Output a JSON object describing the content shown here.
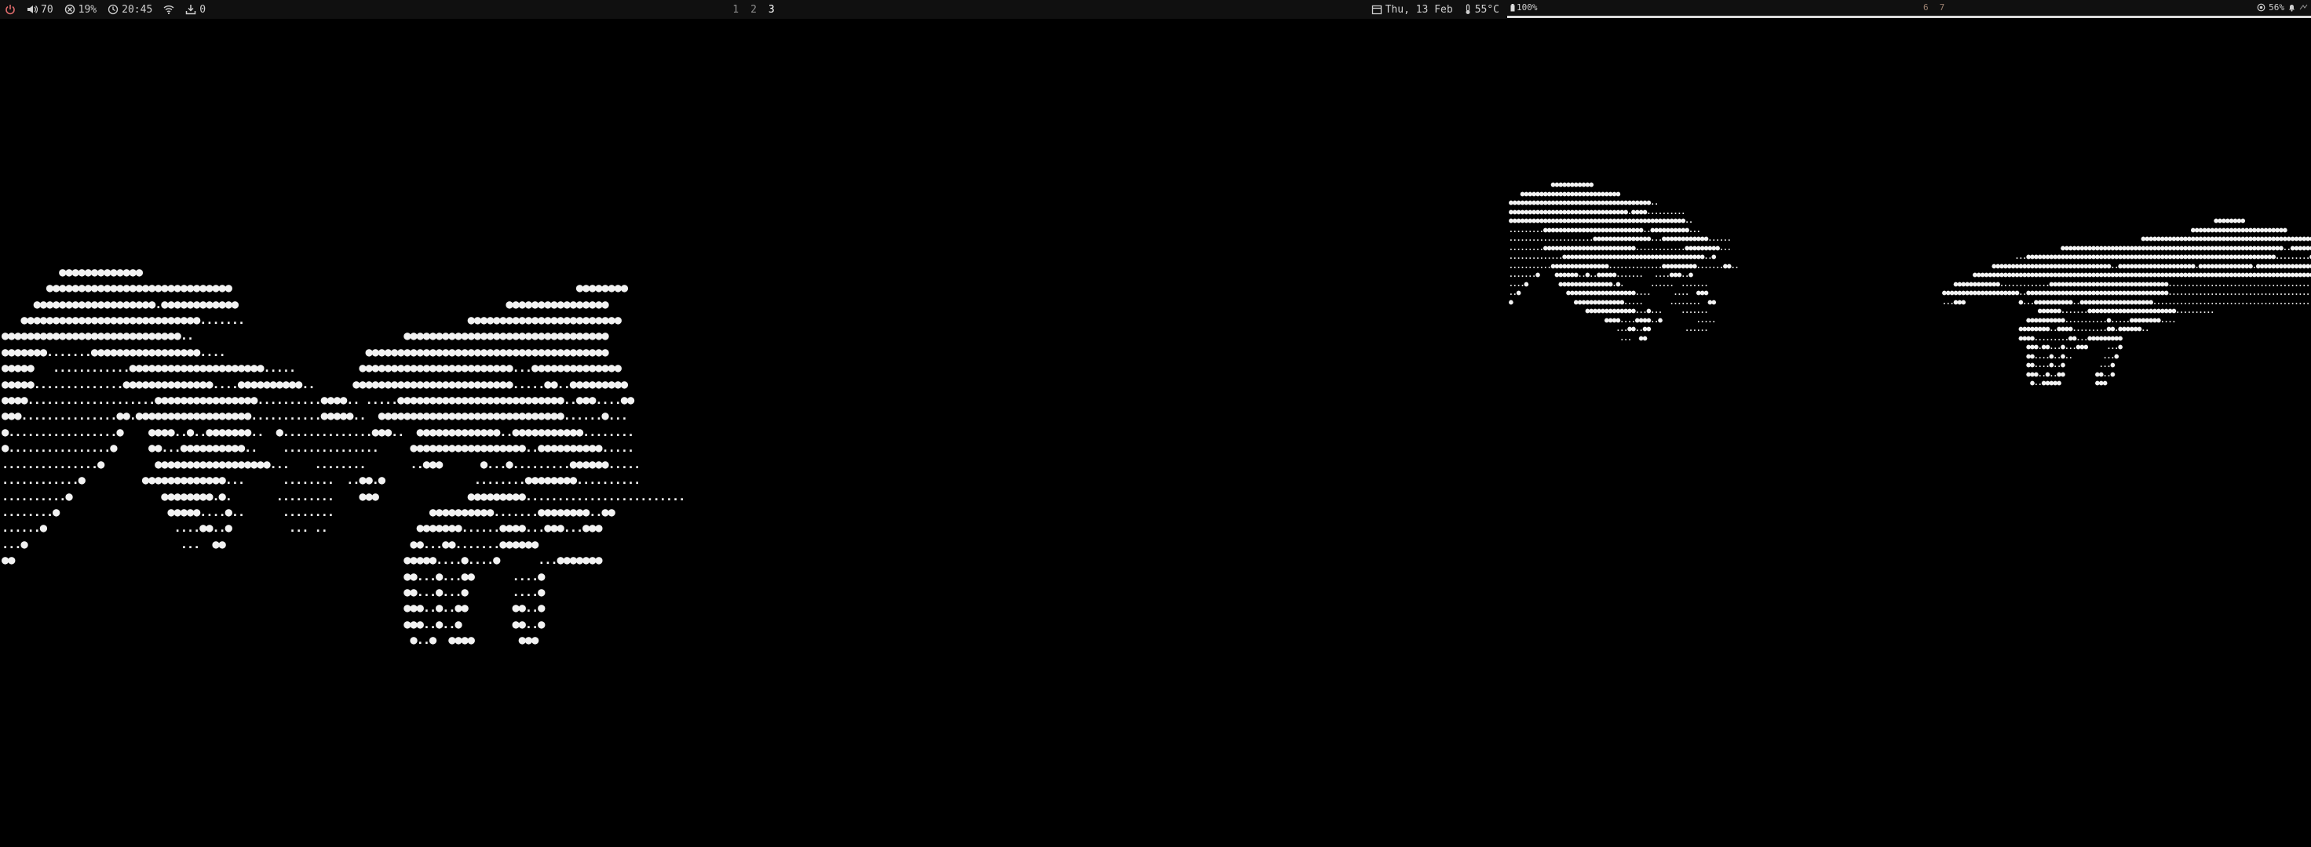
{
  "left_bar": {
    "volume": "70",
    "cpu": "19%",
    "clock": "20:45",
    "updates": "0",
    "workspaces": [
      "1",
      "2",
      "3"
    ],
    "active_workspace": "3",
    "date": "Thu, 13 Feb",
    "temperature": "55°C"
  },
  "right_bar": {
    "battery": "100%",
    "workspaces": [
      "6",
      "7"
    ],
    "memory": "56%"
  },
  "colors": {
    "background": "#000000",
    "bar": "#101010",
    "text": "#cfcfcf",
    "power_icon": "#e06c6c",
    "art": "#f2f2f2"
  },
  "icons": [
    "power-icon",
    "volume-icon",
    "cpu-icon",
    "clock-icon",
    "wifi-icon",
    "download-icon",
    "calendar-icon",
    "thermometer-icon",
    "battery-icon",
    "memory-icon",
    "bell-icon"
  ],
  "art": {
    "left_monitor": [
      "                                    ",
      "                                    ",
      "         ●●●●●●●●●●●●●              ",
      "       ●●●●●●●●●●●●●●●●●●●●●●●●●●●●●                                                      ●●●●●●●●",
      "     ●●●●●●●●●●●●●●●●●●●.●●●●●●●●●●●●                                          ●●●●●●●●●●●●●●●●",
      "   ●●●●●●●●●●●●●●●●●●●●●●●●●●●●.......                                   ●●●●●●●●●●●●●●●●●●●●●●●●",
      "●●●●●●●●●●●●●●●●●●●●●●●●●●●●..                                 ●●●●●●●●●●●●●●●●●●●●●●●●●●●●●●●●",
      "●●●●●●●.......●●●●●●●●●●●●●●●●●....                      ●●●●●●●●●●●●●●●●●●●●●●●●●●●●●●●●●●●●●●",
      "●●●●●   ............●●●●●●●●●●●●●●●●●●●●●.....          ●●●●●●●●●●●●●●●●●●●●●●●●...●●●●●●●●●●●●●●",
      "●●●●●..............●●●●●●●●●●●●●●....●●●●●●●●●●..      ●●●●●●●●●●●●●●●●●●●●●●●●●.....●●..●●●●●●●●●",
      "●●●●....................●●●●●●●●●●●●●●●●..........●●●●.. .....●●●●●●●●●●●●●●●●●●●●●●●●●●..●●●....●●",
      "●●●...............●●.●●●●●●●●●●●●●●●●●●...........●●●●●..  ●●●●●●●●●●●●●●●●●●●●●●●●●●●●●......●...",
      "●.................●    ●●●●..●..●●●●●●●..  ●..............●●●..  ●●●●●●●●●●●●●..●●●●●●●●●●●........",
      "●................●     ●●...●●●●●●●●●●..    ...............     ●●●●●●●●●●●●●●●●●●..●●●●●●●●●●.....",
      "...............●        ●●●●●●●●●●●●●●●●●●...    ........       ..●●●      ●...●.........●●●●●●.....",
      "............●         ●●●●●●●●●●●●●...      ........  ..●●.●              ........●●●●●●●●..........",
      "..........●              ●●●●●●●●.●.       .........    ●●●              ●●●●●●●●●.........................",
      "........●                 ●●●●●....●..      ........               ●●●●●●●●●●.......●●●●●●●●..●●",
      "......●                    ....●●..●         ... ..              ●●●●●●●......●●●●...●●●...●●●",
      "...●                        ...  ●●                             ●●...●●.......●●●●●●",
      "●●                                                             ●●●●●....●....●      ...●●●●●●●",
      "                                                               ●●...●...●●      ....●",
      "                                                               ●●...●...●       ....●",
      "                                                               ●●●..●..●●       ●●..●",
      "                                                               ●●●..●..●        ●●..●",
      "                                                                ●..●  ●●●●       ●●●"
    ],
    "right_monitor_left": [
      "           ●●●●●●●●●●●",
      "   ●●●●●●●●●●●●●●●●●●●●●●●●●●",
      "●●●●●●●●●●●●●●●●●●●●●●●●●●●●●●●●●●●●●..",
      "●●●●●●●●●●●●●●●●●●●●●●●●●●●●●●●.●●●●..........",
      "●●●●●●●●●●●●●●●●●●●●●●●●●●●●●●●●●●●●●●●●●●●●●●..",
      ".........●●●●●●●●●●●●●●●●●●●●●●●●●●..●●●●●●●●●●...",
      "......................●●●●●●●●●●●●●●●...●●●●●●●●●●●●......",
      ".........●●●●●●●●●●●●●●●●●●●●●●●●.............●●●●●●●●●...",
      "..............●●●●●●●●●●●●●●●●●●●●●●●●●●●●●●●●●●●●●..●",
      "...........●●●●●●●●●●●●●●●..............●●●●●●●●●.......●●..",
      ".......●    ●●●●●●..●..●●●●●.......   ....●●●..●",
      "....●        ●●●●●●●●●●●●●●.●.       ......  .......",
      "..●            ●●●●●●●●●●●●●●●●●●....      ....  ●●●",
      "●                ●●●●●●●●●●●●●.....       ........  ●●",
      "                    ●●●●●●●●●●●●●...●...     .......",
      "                         ●●●●....●●●●..●         .....",
      "                            ...●●..●●         ......",
      "                             ...  ●●"
    ],
    "right_monitor_right": [
      "                                                                       ●●●●●●●●",
      "                                                                 ●●●●●●●●●●●●●●●●●●●●●●●●●",
      "                                                    ●●●●●●●●●●●●●●●●●●●●●●●●●●●●●●●●●●●●●●●●●●●●●●",
      "                               ●●●●●●●●●●●●●●●●●●●●●●●●●●●●●●●●●●●●●●●●●●●●●●●●●●●●●●●●●●..●●●●●●●●●●●●●",
      "                   ...●●●●●●●●●●●●●●●●●●●●●●●●●●●●●●●●●●●●●●●●●●●●●●●●●●●●●●●●●●●●●●●●●.........●●●●●●●",
      "             ●●●●●●●●●●●●●●●●●●●●●●●●●●●●●●●..●●●●●●●●●●●●●●●●●●●●.●●●●●●●●●●●●●●.●●●●●●●●●●●●●●●●●●●●●",
      "        ●●●●●●●●●●●●●●●●●●●●●●●●●●●●●●●●●●●●●●●●●●●●●●●●●●●●●●●●●●●●●●●●●●●●●●●●●●●●●●●●●●●●●●●●●●●●",
      "   ●●●●●●●●●●●●.............●●●●●●●●●●●●●●●●●●●●●●●●●●●●●●●..........................................",
      "●●●●●●●●●●●●●●●●●●●●..●●●●●●●●●●●●●●●●●●●●●●●●●●●●●●●●●●●●●.............................................",
      "...●●●              ●...●●●●●●●●●●..●●●●●●●●●●●●●●●●●●●............................................",
      "                         ●●●●●●.......●●●●●●●●●●●●●●●●●●●●●●●..........",
      "                      ●●●●●●●●●●...........●.....●●●●●●●●....",
      "                    ●●●●●●●●..●●●●.........●●.●●●●●●..",
      "                    ●●●●.........●●...●●●●●●●●●",
      "                      ●●●.●●...●...●●●     ...●",
      "                      ●●....●..●..        ...●",
      "                      ●●....●..●         ...●",
      "                      ●●●..●..●●        ●●..●",
      "                       ●..●●●●●         ●●●"
    ]
  }
}
